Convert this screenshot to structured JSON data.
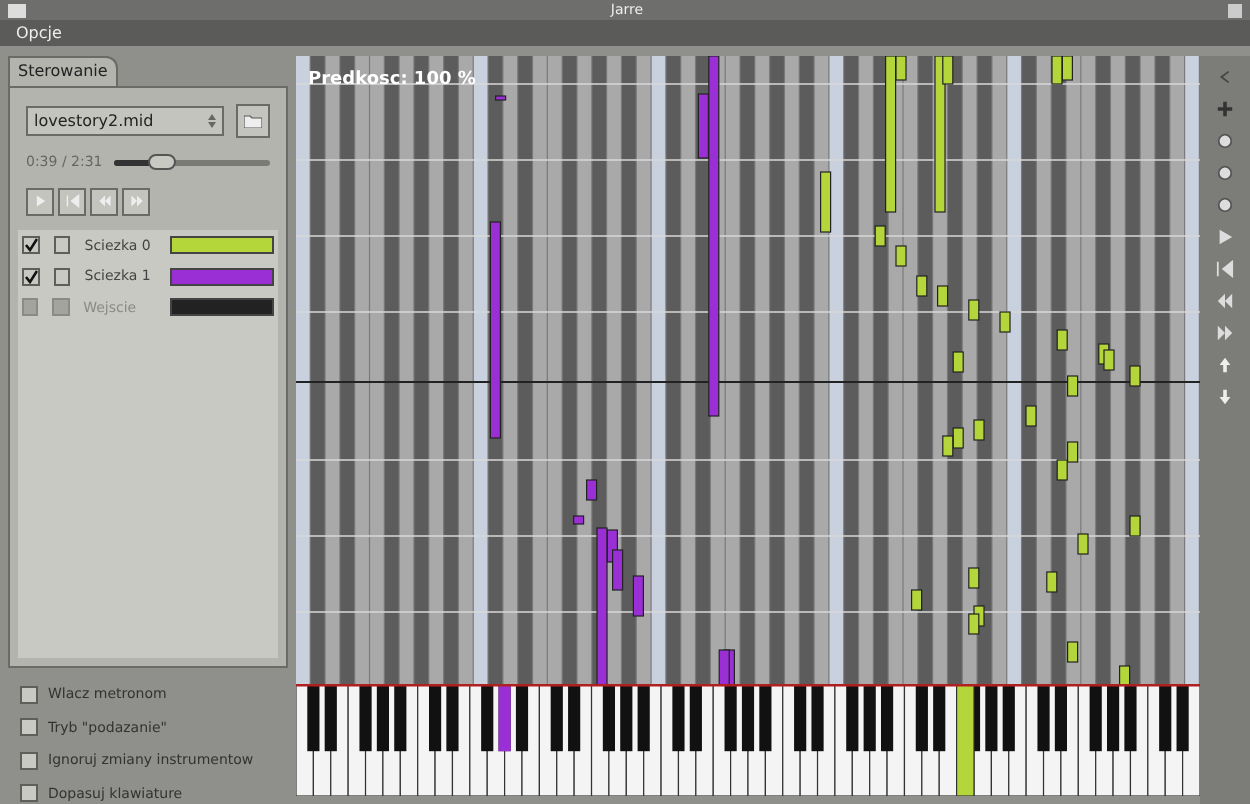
{
  "window": {
    "title": "Jarre"
  },
  "menu": [
    "Opcje"
  ],
  "tabs": [
    {
      "label": "Sterowanie",
      "selected": true
    }
  ],
  "file": {
    "value": "lovestory2.mid"
  },
  "position": {
    "reading": "0:39 / 2:31",
    "level": 0.3
  },
  "tracks": [
    {
      "name": "Sciezka 0",
      "checked": true,
      "solo": false,
      "disabled": false,
      "color": "#b5d63a"
    },
    {
      "name": "Sciezka 1",
      "checked": true,
      "solo": false,
      "disabled": false,
      "color": "#9b2fd6"
    },
    {
      "name": "Wejscie",
      "checked": false,
      "solo": false,
      "disabled": true,
      "color": "#222222"
    }
  ],
  "options": [
    {
      "label": "Wlacz metronom",
      "checked": false
    },
    {
      "label": "Tryb \"podazanie\"",
      "checked": false
    },
    {
      "label": "Ignoruj zmiany instrumentow",
      "checked": false
    },
    {
      "label": "Dopasuj klawiature",
      "checked": false
    }
  ],
  "roll": {
    "speed": "Predkosc: 100 %"
  }
}
